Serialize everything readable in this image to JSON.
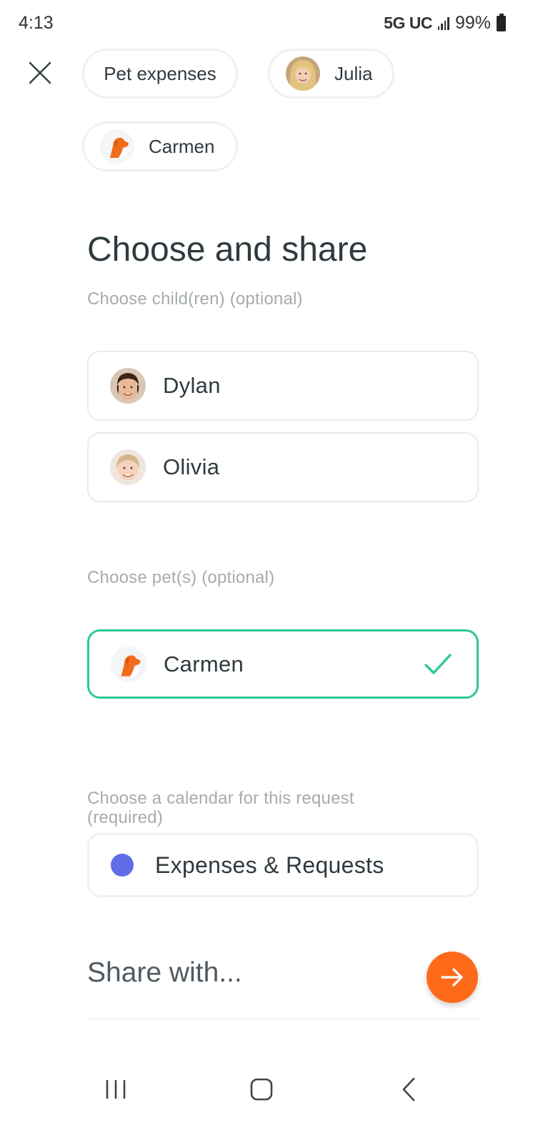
{
  "status_bar": {
    "time": "4:13",
    "network": "5G UC",
    "battery": "99%"
  },
  "chips": {
    "category": "Pet expenses",
    "person": "Julia",
    "pet": "Carmen"
  },
  "title": "Choose and share",
  "children_section": {
    "label": "Choose child(ren) (optional)",
    "items": [
      {
        "name": "Dylan",
        "selected": false
      },
      {
        "name": "Olivia",
        "selected": false
      }
    ]
  },
  "pets_section": {
    "label": "Choose pet(s) (optional)",
    "items": [
      {
        "name": "Carmen",
        "selected": true
      }
    ]
  },
  "calendar_section": {
    "label": "Choose a calendar for this request (required)",
    "selected": "Expenses & Requests",
    "dot_color": "#5f6ce8"
  },
  "share": {
    "label": "Share with..."
  },
  "colors": {
    "accent_orange": "#ff6a1a",
    "selected_green": "#2dc997",
    "text_dark": "#2f3a3f",
    "text_muted": "#a6abae"
  },
  "icons": {
    "close": "close-icon",
    "check": "check-icon",
    "next": "arrow-right-icon",
    "pet": "dog-icon"
  }
}
